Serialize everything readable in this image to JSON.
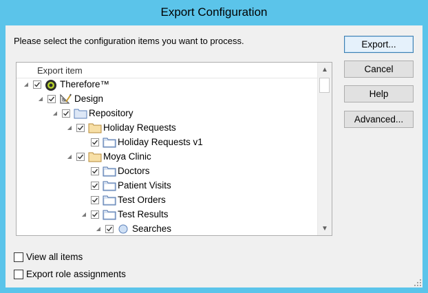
{
  "window": {
    "title": "Export Configuration"
  },
  "instruction": "Please select the configuration items you want to process.",
  "tree": {
    "column_header": "Export item",
    "rows": [
      {
        "label": "Therefore™",
        "indent": 0,
        "expanded": true,
        "checked": true,
        "icon": "therefore-logo-icon"
      },
      {
        "label": "Design",
        "indent": 1,
        "expanded": true,
        "checked": true,
        "icon": "design-tools-icon"
      },
      {
        "label": "Repository",
        "indent": 2,
        "expanded": true,
        "checked": true,
        "icon": "repository-folder-icon"
      },
      {
        "label": "Holiday Requests",
        "indent": 3,
        "expanded": true,
        "checked": true,
        "icon": "folder-icon"
      },
      {
        "label": "Holiday Requests v1",
        "indent": 4,
        "expanded": false,
        "checked": true,
        "icon": "category-icon"
      },
      {
        "label": "Moya Clinic",
        "indent": 3,
        "expanded": true,
        "checked": true,
        "icon": "folder-icon"
      },
      {
        "label": "Doctors",
        "indent": 4,
        "expanded": false,
        "checked": true,
        "icon": "category-icon"
      },
      {
        "label": "Patient Visits",
        "indent": 4,
        "expanded": false,
        "checked": true,
        "icon": "category-icon"
      },
      {
        "label": "Test Orders",
        "indent": 4,
        "expanded": false,
        "checked": true,
        "icon": "category-icon"
      },
      {
        "label": "Test Results",
        "indent": 4,
        "expanded": true,
        "checked": true,
        "icon": "category-icon"
      },
      {
        "label": "Searches",
        "indent": 5,
        "expanded": true,
        "checked": true,
        "icon": "search-icon"
      }
    ]
  },
  "buttons": {
    "export": "Export...",
    "cancel": "Cancel",
    "help": "Help",
    "advanced": "Advanced..."
  },
  "options": {
    "view_all_items": {
      "label": "View all items",
      "checked": false
    },
    "export_role_assignments": {
      "label": "Export role assignments",
      "checked": false
    }
  },
  "colors": {
    "titlebar": "#5bc4ea",
    "accent_border": "#3c7fb1"
  }
}
